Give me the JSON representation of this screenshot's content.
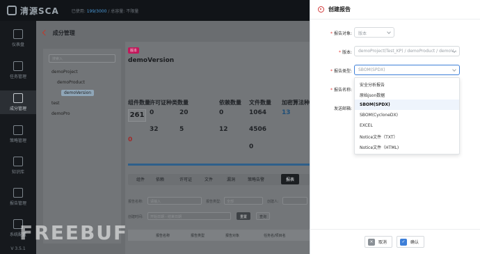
{
  "app": {
    "logo_text": "清源SCA",
    "license_prefix": "已使用:",
    "license_used": "199/3000",
    "license_suffix": "/ 总容量: 不限量"
  },
  "sidebar": {
    "items": [
      {
        "label": "仪表盘",
        "icon": "dashboard-icon"
      },
      {
        "label": "任务管理",
        "icon": "task-icon"
      },
      {
        "label": "成分管理",
        "icon": "component-icon"
      },
      {
        "label": "策略管理",
        "icon": "policy-icon"
      },
      {
        "label": "知识库",
        "icon": "knowledge-icon"
      },
      {
        "label": "报告管理",
        "icon": "report-icon"
      },
      {
        "label": "系统配置",
        "icon": "settings-icon"
      }
    ],
    "version": "V 3.5.1"
  },
  "page": {
    "breadcrumb": "成分管理"
  },
  "tree": {
    "search_placeholder": "搜索入",
    "nodes": [
      "demoProject",
      "demoProduct",
      "demoVersion",
      "test",
      "demoPro"
    ]
  },
  "version_panel": {
    "tag": "版本",
    "title": "demoVersion",
    "stats": [
      {
        "head": "组件数量",
        "value": "261"
      },
      {
        "head": "许可证种类数量",
        "value": "0"
      },
      {
        "head": "依赖数量",
        "value": "0"
      },
      {
        "head": "文件数量",
        "value": "1064"
      },
      {
        "head": "加密算法种",
        "value": "13"
      }
    ],
    "sub_values": [
      "20",
      "5",
      "0",
      "32",
      "12",
      "4506"
    ],
    "tabs": [
      "组件",
      "依赖",
      "许可证",
      "文件",
      "漏洞",
      "策略告警",
      "报表"
    ],
    "filters": {
      "name_label": "报告名称:",
      "name_placeholder": "请输入",
      "type_label": "报告类型:",
      "type_value": "全部",
      "creator_label": "创建人:",
      "time_label": "创建时间:",
      "time_start": "开始日期",
      "time_sep": "-",
      "time_end": "结束日期",
      "reset": "重置",
      "query": "查询"
    },
    "table_headers": [
      "报告名称",
      "报告类型",
      "报告对象",
      "任务名/项目名"
    ]
  },
  "watermark": "FREEBUF",
  "dialog": {
    "title": "创建报告",
    "fields": {
      "target_label": "报告对象:",
      "target_value": "版本",
      "version_label": "版本:",
      "version_value": "demoProject(Test_KP) / demoProduct / demoV...",
      "type_label": "报告类型:",
      "type_value": "SBOM(SPDX)",
      "name_label": "报告名称:",
      "email_label": "发送邮箱:"
    },
    "dropdown_options": [
      "安全分析报告",
      "原始json数据",
      "SBOM(SPDX)",
      "SBOM(CycloneDX)",
      "EXCEL",
      "Notice文件（TXT）",
      "Notice文件（HTML)"
    ],
    "selected_option_index": 2,
    "cancel_label": "取消",
    "confirm_label": "确认"
  },
  "colors": {
    "accent": "#3d7fd8",
    "required": "#e53935",
    "header_icon": "#d23a3a"
  }
}
